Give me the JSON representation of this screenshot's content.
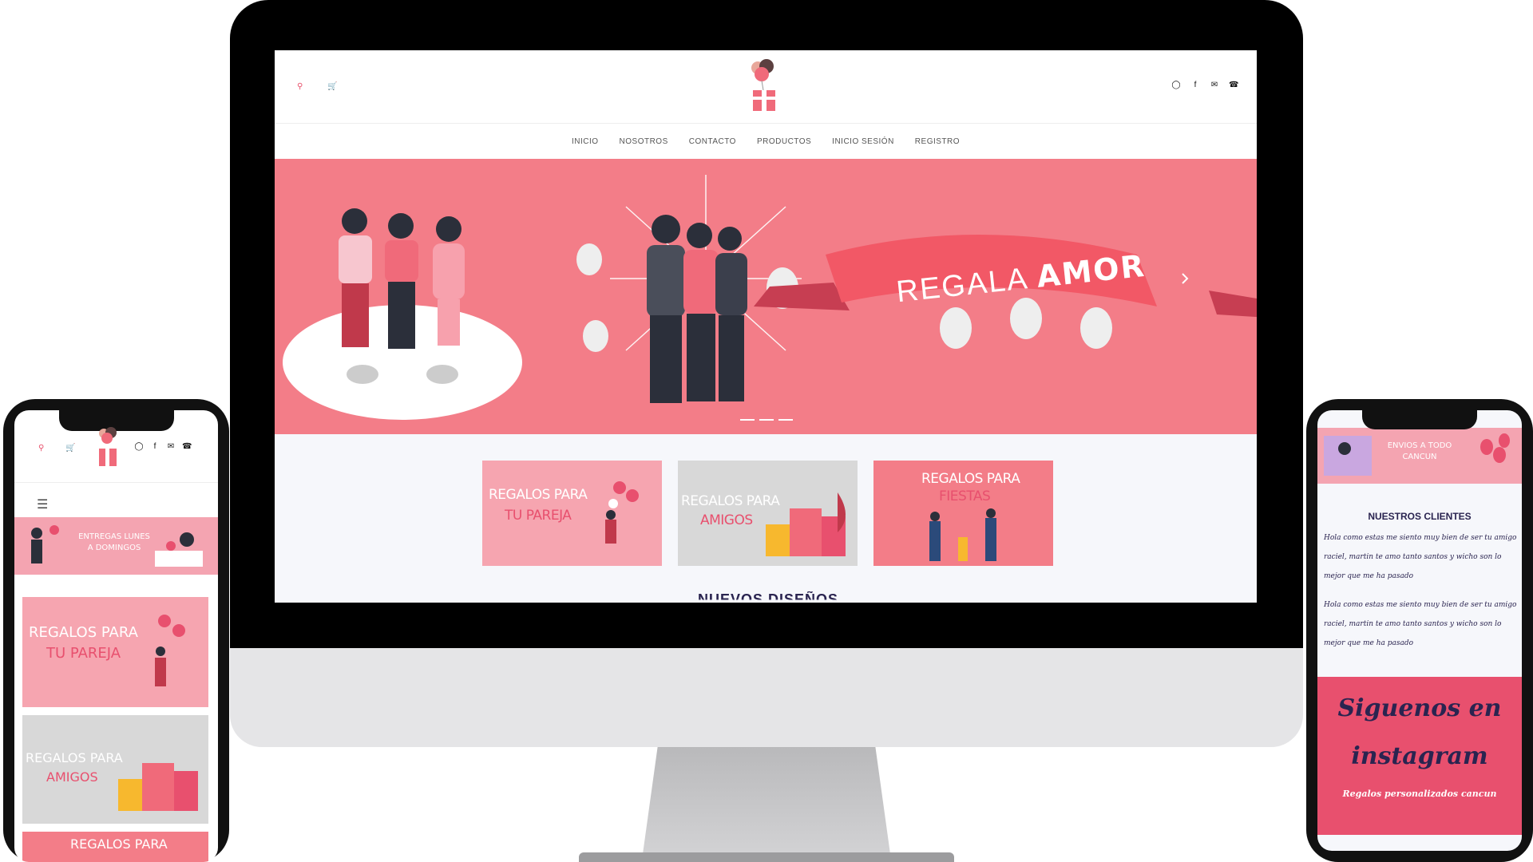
{
  "desktop": {
    "nav": [
      "INICIO",
      "NOSOTROS",
      "CONTACTO",
      "PRODUCTOS",
      "INICIO SESIÓN",
      "REGISTRO"
    ],
    "hero": {
      "word1": "REGALA",
      "word2": "AMOR"
    },
    "cards": [
      {
        "line1": "REGALOS PARA",
        "line2": "TU PAREJA"
      },
      {
        "line1": "REGALOS PARA",
        "line2": "AMIGOS"
      },
      {
        "line1": "REGALOS PARA",
        "line2": "FIESTAS"
      }
    ],
    "section_title_partial": "NUEVOS DISEÑOS"
  },
  "left_phone": {
    "banner": {
      "line1": "ENTREGAS LUNES",
      "line2": "A DOMINGOS"
    },
    "cards": [
      {
        "line1": "REGALOS PARA",
        "line2": "TU PAREJA"
      },
      {
        "line1": "REGALOS PARA",
        "line2": "AMIGOS"
      },
      {
        "line1": "REGALOS PARA"
      }
    ]
  },
  "right_phone": {
    "banner": {
      "line1": "ENVIOS A TODO",
      "line2": "CANCUN"
    },
    "clients_title": "NUESTROS CLIENTES",
    "testimonials": [
      "Hola como estas me siento muy bien de ser tu amigo raciel, martin te amo tanto santos y wicho son lo mejor que me ha pasado",
      "Hola como estas me siento muy bien de ser tu amigo raciel, martin te amo tanto santos y wicho son lo mejor que me ha pasado"
    ],
    "insta": {
      "line1": "Siguenos en",
      "line2": "instagram",
      "sub": "Regalos personalizados cancun"
    }
  },
  "colors": {
    "pink": "#f37d88",
    "deep_pink": "#e8506e",
    "navy": "#2a2450"
  }
}
